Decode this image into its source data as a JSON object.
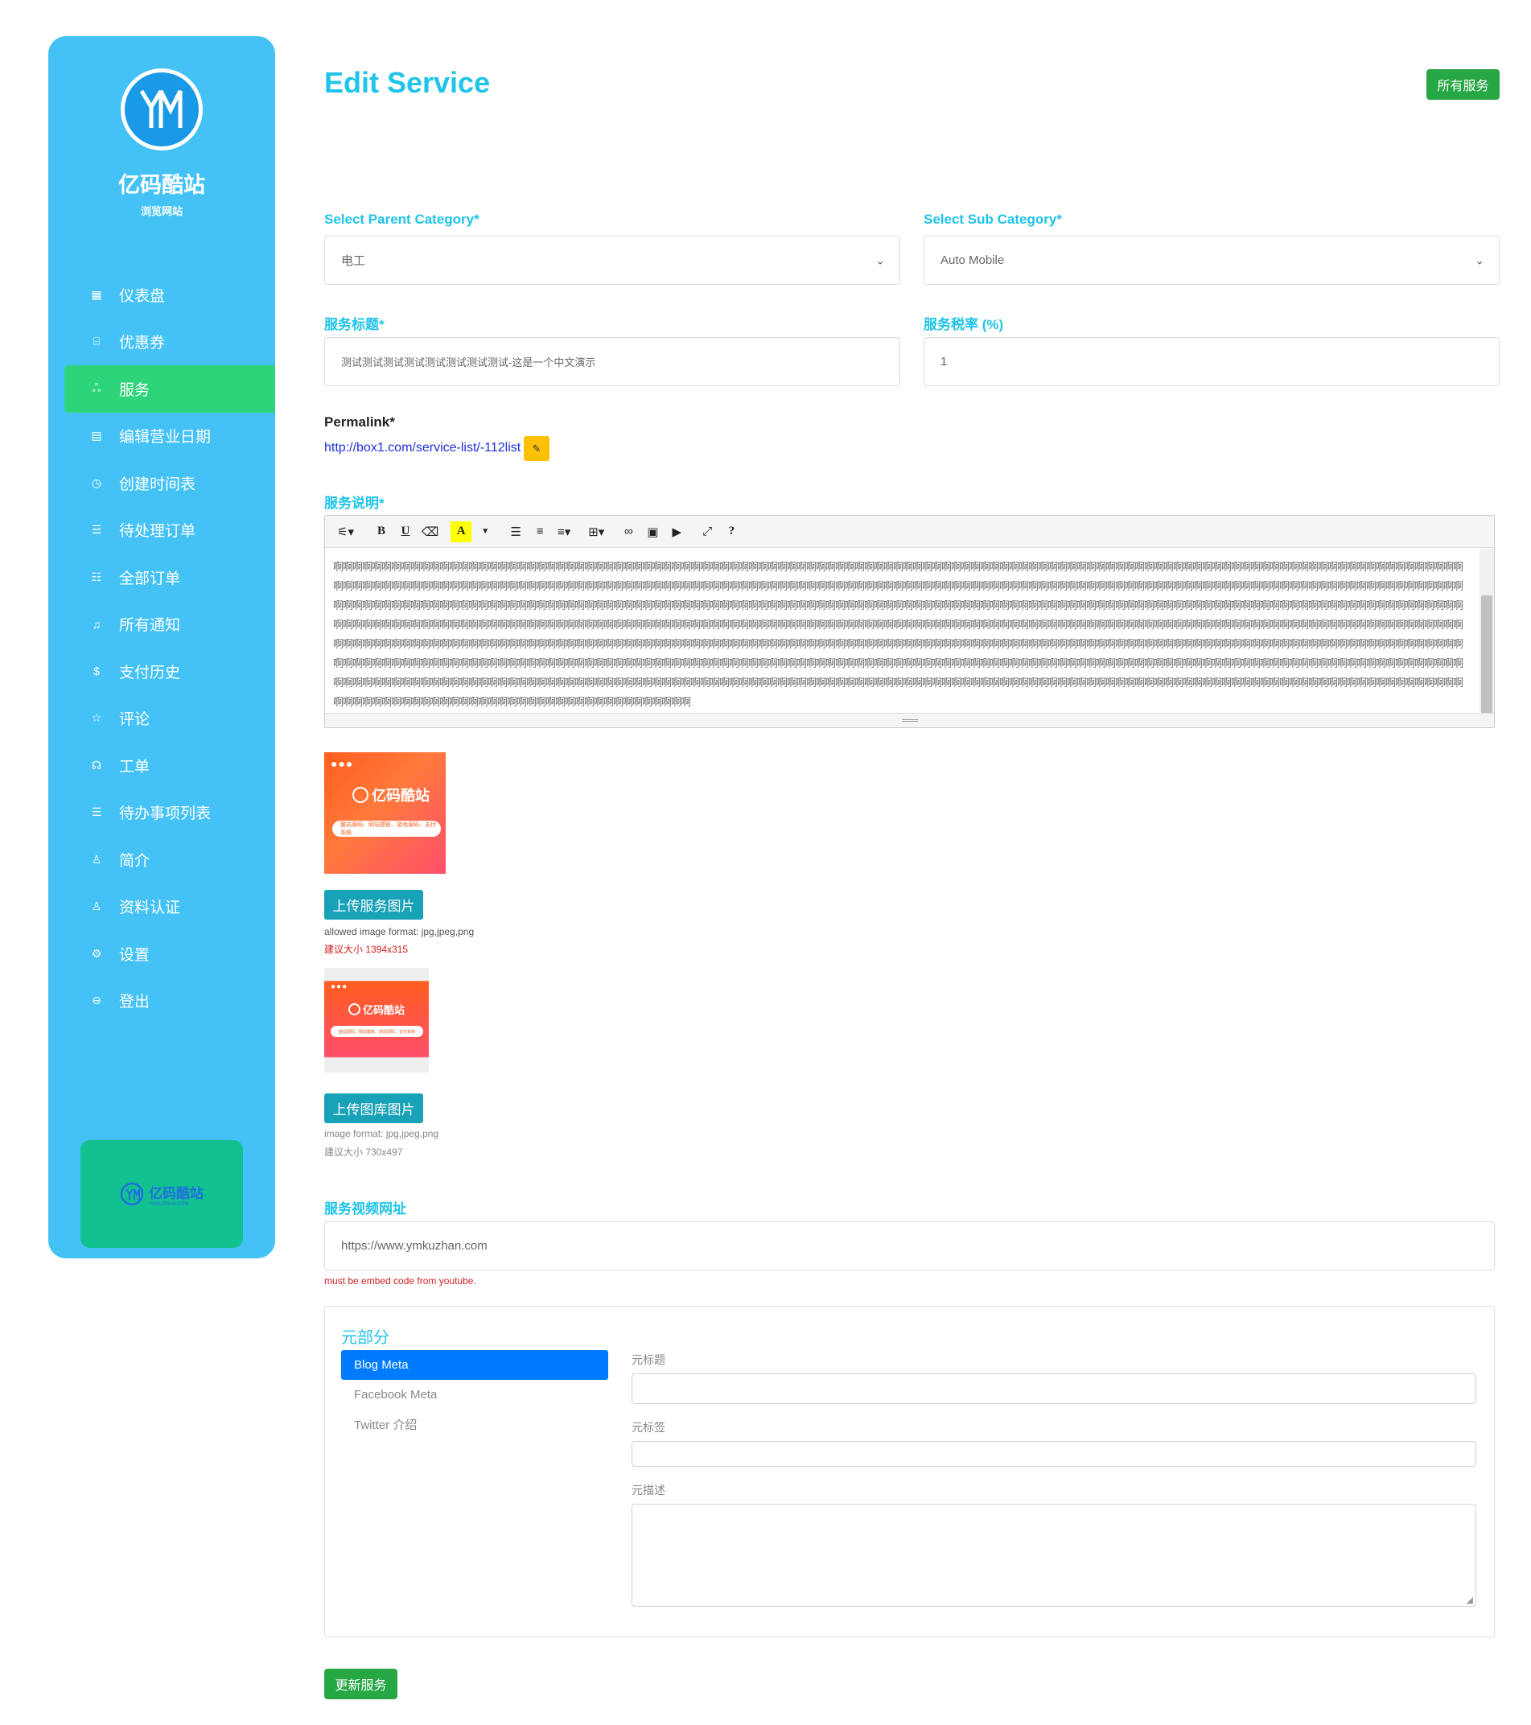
{
  "sidebar": {
    "brand_name": "亿码酷站",
    "brand_sub": "浏览网站",
    "items": [
      {
        "label": "仪表盘",
        "icon": "dashboard-icon",
        "glyph": "▦"
      },
      {
        "label": "优惠券",
        "icon": "coupon-icon",
        "glyph": "⌸"
      },
      {
        "label": "服务",
        "icon": "services-icon",
        "glyph": "ஃ"
      },
      {
        "label": "编辑营业日期",
        "icon": "calendar-icon",
        "glyph": "▤"
      },
      {
        "label": "创建时间表",
        "icon": "clock-icon",
        "glyph": "◷"
      },
      {
        "label": "待处理订单",
        "icon": "pending-list-icon",
        "glyph": "☰"
      },
      {
        "label": "全部订单",
        "icon": "orders-list-icon",
        "glyph": "☷"
      },
      {
        "label": "所有通知",
        "icon": "bell-icon",
        "glyph": "♫"
      },
      {
        "label": "支付历史",
        "icon": "dollar-icon",
        "glyph": "$"
      },
      {
        "label": "评论",
        "icon": "star-icon",
        "glyph": "☆"
      },
      {
        "label": "工单",
        "icon": "headset-icon",
        "glyph": "☊"
      },
      {
        "label": "待办事项列表",
        "icon": "todo-icon",
        "glyph": "☰"
      },
      {
        "label": "简介",
        "icon": "user-icon",
        "glyph": "♙"
      },
      {
        "label": "资料认证",
        "icon": "verify-user-icon",
        "glyph": "♙"
      },
      {
        "label": "设置",
        "icon": "gear-icon",
        "glyph": "⚙"
      },
      {
        "label": "登出",
        "icon": "logout-icon",
        "glyph": "⊖"
      }
    ],
    "active_index": 2,
    "promo_text": "亿码酷站",
    "promo_sub": "YMKUZHAN.COM"
  },
  "header": {
    "title": "Edit Service",
    "all_services_button": "所有服务"
  },
  "form": {
    "parent_category_label": "Select Parent Category*",
    "parent_category_value": "电工",
    "sub_category_label": "Select Sub Category*",
    "sub_category_value": "Auto Mobile",
    "service_title_label": "服务标题*",
    "service_title_value": "测试测试测试测试测试测试测试测试-这是一个中文演示",
    "tax_label": "服务税率 (%)",
    "tax_value": "1",
    "permalink_label": "Permalink*",
    "permalink_url": "http://box1.com/service-list/-112list",
    "description_label": "服务说明*",
    "description_text": "啊啊啊啊啊啊啊啊啊啊啊啊啊啊啊啊啊啊啊啊啊啊啊啊啊啊啊啊啊啊啊啊啊啊啊啊啊啊啊啊啊啊啊啊啊啊啊啊啊啊啊啊啊啊啊啊啊啊啊啊啊啊啊啊啊啊啊啊啊啊啊啊啊啊啊啊啊啊啊啊啊啊啊啊啊啊啊啊啊啊啊啊啊啊啊啊啊啊啊啊啊啊啊啊啊啊啊啊啊啊啊啊啊啊啊啊啊啊啊啊啊啊啊啊啊啊啊啊啊啊啊啊啊啊啊啊啊啊啊啊啊啊啊啊啊啊啊啊啊啊啊啊啊啊啊啊啊啊啊啊啊啊啊啊啊啊啊啊啊啊啊啊啊啊啊啊啊啊啊啊啊啊啊啊啊啊啊啊啊啊啊啊啊啊啊啊啊啊啊啊啊啊啊啊啊啊啊啊啊啊啊啊啊啊啊啊啊啊啊啊啊啊啊啊啊啊啊啊啊啊啊啊啊啊啊啊啊啊啊啊啊啊啊啊啊啊啊啊啊啊啊啊啊啊啊啊啊啊啊啊啊啊啊啊啊啊啊啊啊啊啊啊啊啊啊啊啊啊啊啊啊啊啊啊啊啊啊啊啊啊啊啊啊啊啊啊啊啊啊啊啊啊啊啊啊啊啊啊啊啊啊啊啊啊啊啊啊啊啊啊啊啊啊啊啊啊啊啊啊啊啊啊啊啊啊啊啊啊啊啊啊啊啊啊啊啊啊啊啊啊啊啊啊啊啊啊啊啊啊啊啊啊啊啊啊啊啊啊啊啊啊啊啊啊啊啊啊啊啊啊啊啊啊啊啊啊啊啊啊啊啊啊啊啊啊啊啊啊啊啊啊啊啊啊啊啊啊啊啊啊啊啊啊啊啊啊啊啊啊啊啊啊啊啊啊啊啊啊啊啊啊啊啊啊啊啊啊啊啊啊啊啊啊啊啊啊啊啊啊啊啊啊啊啊啊啊啊啊啊啊啊啊啊啊啊啊啊啊啊啊啊啊啊啊啊啊啊啊啊啊啊啊啊啊啊啊啊啊啊啊啊啊啊啊啊啊啊啊啊啊啊啊啊啊啊啊啊啊啊啊啊啊啊啊啊啊啊啊啊啊啊啊啊啊啊啊啊啊啊啊啊啊啊啊啊啊啊啊啊啊啊啊啊啊啊啊啊啊啊啊啊啊啊啊啊啊啊啊啊啊啊啊啊啊啊啊啊啊啊啊啊啊啊啊啊啊啊啊啊啊啊啊啊啊啊啊啊啊啊啊啊啊啊啊啊啊啊啊啊啊啊啊啊啊啊啊啊啊啊啊啊啊啊啊啊啊啊啊啊啊啊啊啊啊啊啊啊啊啊啊啊啊啊啊啊啊啊啊啊啊啊啊啊啊啊啊啊啊啊啊啊啊啊啊啊啊啊啊啊啊啊啊啊啊啊啊啊啊啊啊啊啊啊啊啊啊啊啊啊啊啊啊啊啊啊啊啊啊啊啊啊啊啊啊啊啊啊啊啊啊啊啊啊啊啊啊啊啊啊啊啊啊啊啊啊啊啊啊啊啊啊啊啊啊啊啊啊啊啊啊啊啊啊啊啊啊啊啊啊啊啊啊啊啊啊啊啊啊啊啊啊啊啊啊啊啊啊啊啊啊啊啊啊啊啊啊啊啊啊啊啊啊啊啊啊啊啊啊啊啊啊啊啊啊啊啊啊啊啊啊啊啊啊啊啊啊啊啊啊啊啊啊啊啊啊啊啊啊啊啊啊啊啊啊啊啊啊啊啊啊啊啊啊啊啊啊啊啊啊啊啊啊啊啊啊啊啊啊啊啊啊啊啊啊啊啊啊啊啊啊啊啊啊啊啊啊",
    "upload_service_image_button": "上传服务图片",
    "service_image_format_hint": "allowed image format: jpg,jpeg,png",
    "service_image_size_hint": "建议大小 1394x315",
    "upload_gallery_button": "上传图库图片",
    "gallery_format_hint": "image format: jpg,jpeg,png",
    "gallery_size_hint": "建议大小 730x497",
    "video_label": "服务视频网址",
    "video_value": "https://www.ymkuzhan.com",
    "video_hint": "must be embed code from youtube.",
    "update_button": "更新服务"
  },
  "image_thumb": {
    "brand": "亿码酷站",
    "domain": "YMKUZHAN.COM",
    "bar_text": "整站源码、网站模板、游戏源码、支付系统"
  },
  "meta": {
    "title": "元部分",
    "tabs": [
      "Blog Meta",
      "Facebook Meta",
      "Twitter 介绍"
    ],
    "meta_title_label": "元标题",
    "meta_tags_label": "元标签",
    "meta_description_label": "元描述"
  },
  "colors": {
    "sidebar_bg": "#44c2f5",
    "active_item": "#2ed47a",
    "accent_heading": "#1fc4e8",
    "success_button": "#28a745",
    "teal_button": "#17a2b8",
    "warning_button": "#ffc107",
    "primary_tab": "#007bff"
  }
}
